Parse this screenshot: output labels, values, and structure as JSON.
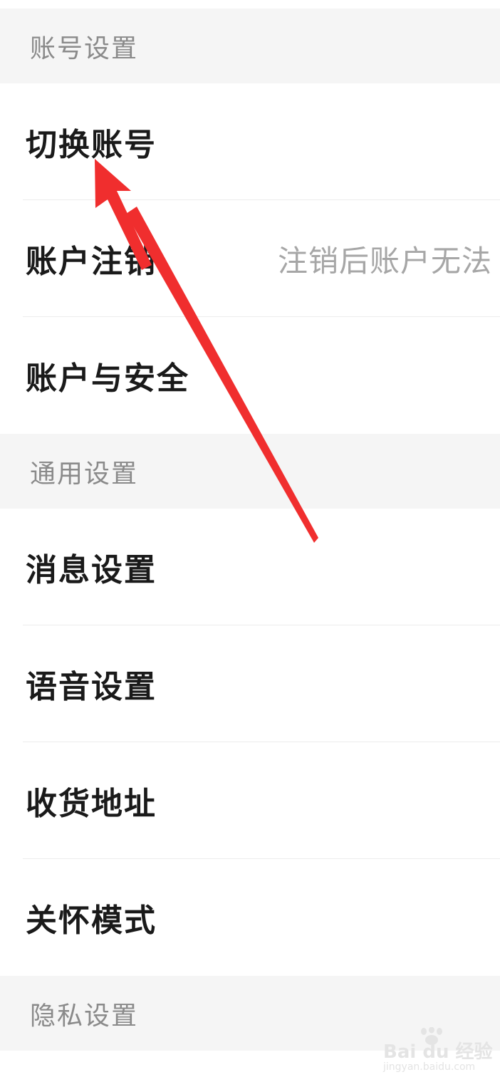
{
  "sections": [
    {
      "title": "账号设置",
      "items": [
        {
          "label": "切换账号",
          "value": ""
        },
        {
          "label": "账户注销",
          "value": "注销后账户无法"
        },
        {
          "label": "账户与安全",
          "value": ""
        }
      ]
    },
    {
      "title": "通用设置",
      "items": [
        {
          "label": "消息设置"
        },
        {
          "label": "语音设置"
        },
        {
          "label": "收货地址"
        },
        {
          "label": "关怀模式"
        }
      ]
    },
    {
      "title": "隐私设置",
      "items": []
    }
  ],
  "annotation": {
    "color": "#f02e2e",
    "icon": "arrow-pointing-icon"
  },
  "watermark": {
    "brand": "Bai du 经验",
    "url": "jingyan.baidu.com",
    "icon": "paw-logo-icon"
  }
}
